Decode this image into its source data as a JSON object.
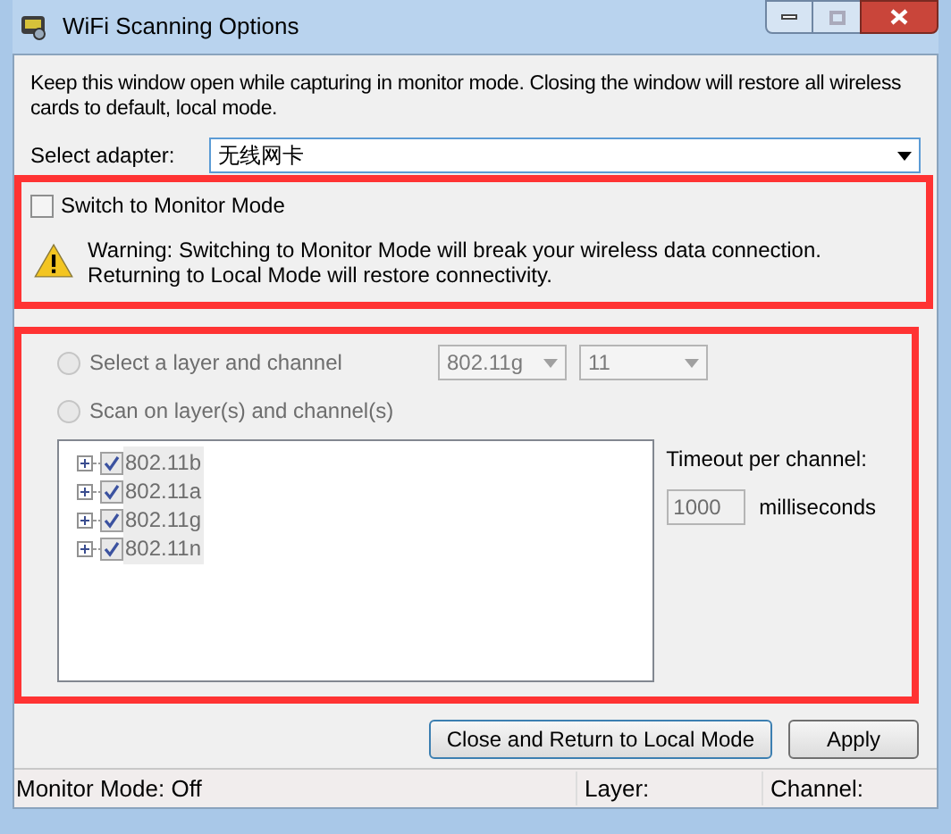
{
  "window": {
    "title": "WiFi Scanning Options"
  },
  "intro": "Keep this window open while capturing in monitor mode. Closing the window will restore all wireless cards to default, local mode.",
  "adapter": {
    "label": "Select adapter:",
    "value": "无线网卡"
  },
  "monitor": {
    "label": "Switch to Monitor Mode",
    "checked": false,
    "warning": "Warning: Switching to Monitor Mode will break your wireless data connection. Returning to Local Mode will restore connectivity."
  },
  "scan": {
    "disabled": true,
    "options": [
      {
        "label": "Select a layer and channel",
        "selected": false
      },
      {
        "label": "Scan on layer(s) and channel(s)",
        "selected": false
      }
    ],
    "layer": "802.11g",
    "channel": "11",
    "tree": [
      {
        "label": "802.11b",
        "checked": true,
        "expanded": false
      },
      {
        "label": "802.11a",
        "checked": true,
        "expanded": false
      },
      {
        "label": "802.11g",
        "checked": true,
        "expanded": false
      },
      {
        "label": "802.11n",
        "checked": true,
        "expanded": false
      }
    ],
    "timeout_label": "Timeout per channel:",
    "timeout": "1000",
    "timeout_unit": "milliseconds"
  },
  "buttons": [
    {
      "label": "Close and Return to Local Mode",
      "selected": true
    },
    {
      "label": "Apply",
      "selected": false
    }
  ],
  "status_bar": [
    "Monitor Mode: Off",
    "Layer:",
    "Channel:"
  ]
}
